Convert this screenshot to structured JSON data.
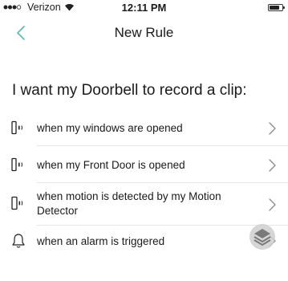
{
  "status_bar": {
    "carrier": "Verizon",
    "time": "12:11 PM",
    "signal_icon": "signal-dots-icon",
    "wifi_icon": "wifi-icon",
    "battery_icon": "battery-icon"
  },
  "nav": {
    "title": "New Rule",
    "back_icon": "chevron-left-icon"
  },
  "heading": "I want my Doorbell to record a clip:",
  "options": [
    {
      "label": "when my windows are opened",
      "icon": "contact-sensor-icon"
    },
    {
      "label": "when my Front Door is opened",
      "icon": "contact-sensor-icon"
    },
    {
      "label": "when motion is detected by my Motion Detector",
      "icon": "motion-sensor-icon"
    },
    {
      "label": "when an alarm is triggered",
      "icon": "bell-icon"
    }
  ],
  "colors": {
    "accent": "#5bb8b4",
    "text": "#1a1a1a",
    "divider": "#e6e6e6",
    "chevron": "#8a8a8a"
  }
}
